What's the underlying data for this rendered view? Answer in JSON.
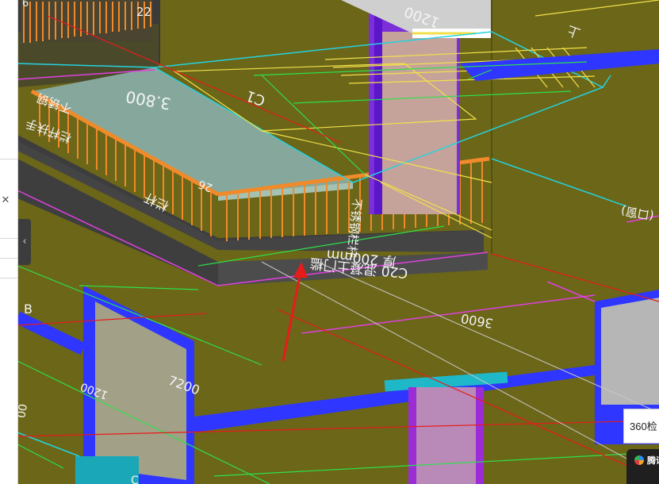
{
  "viewport": {
    "grid_axes": {
      "b": "B",
      "c": "C",
      "six": "6"
    },
    "dims": {
      "d22": "22",
      "d3800": "3.800",
      "d1200": "1200",
      "d3600": "3600",
      "d7200": "7200",
      "d1200b": "1200",
      "d00": "00",
      "d26": "26",
      "dm200": "200mm"
    },
    "notes": {
      "slab_label": "C20 混凝土门槛",
      "thickness": "厚 200mm",
      "railing": "不锈钢栏杆",
      "railing2": "栏杆",
      "room": "C1",
      "left_note": "不锈钢",
      "left_note2": "栏杆扶手",
      "right_top": "上",
      "right_note": "(口窗)"
    }
  },
  "popup": {
    "text": "360检"
  },
  "toast": {
    "text": "腾讯"
  },
  "colors": {
    "olive": "#6b6618",
    "blue": "#1f2cff",
    "orange": "#f08a2a",
    "cyan": "#22c8d8"
  }
}
